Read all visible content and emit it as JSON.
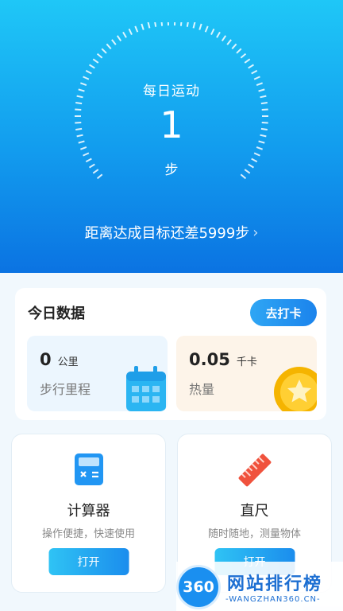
{
  "hero": {
    "title": "每日运动",
    "steps": "1",
    "unit": "步",
    "goal_text": "距离达成目标还差5999步",
    "goal_chevron": "›"
  },
  "today": {
    "title": "今日数据",
    "checkin_label": "去打卡",
    "distance": {
      "value": "0",
      "unit": "公里",
      "label": "步行里程"
    },
    "calories": {
      "value": "0.05",
      "unit": "千卡",
      "label": "热量"
    }
  },
  "tools": [
    {
      "name": "计算器",
      "desc": "操作便捷，快速使用",
      "button": "打开",
      "icon": "calculator-icon"
    },
    {
      "name": "直尺",
      "desc": "随时随地，测量物体",
      "button": "打开",
      "icon": "ruler-icon"
    }
  ],
  "watermark": {
    "badge": "360",
    "name": "网站排行榜",
    "url": "-WANGZHAN360.CN-"
  },
  "colors": {
    "hero_top": "#1fc7f7",
    "hero_bottom": "#0b73e2",
    "accent": "#1b83ec"
  }
}
